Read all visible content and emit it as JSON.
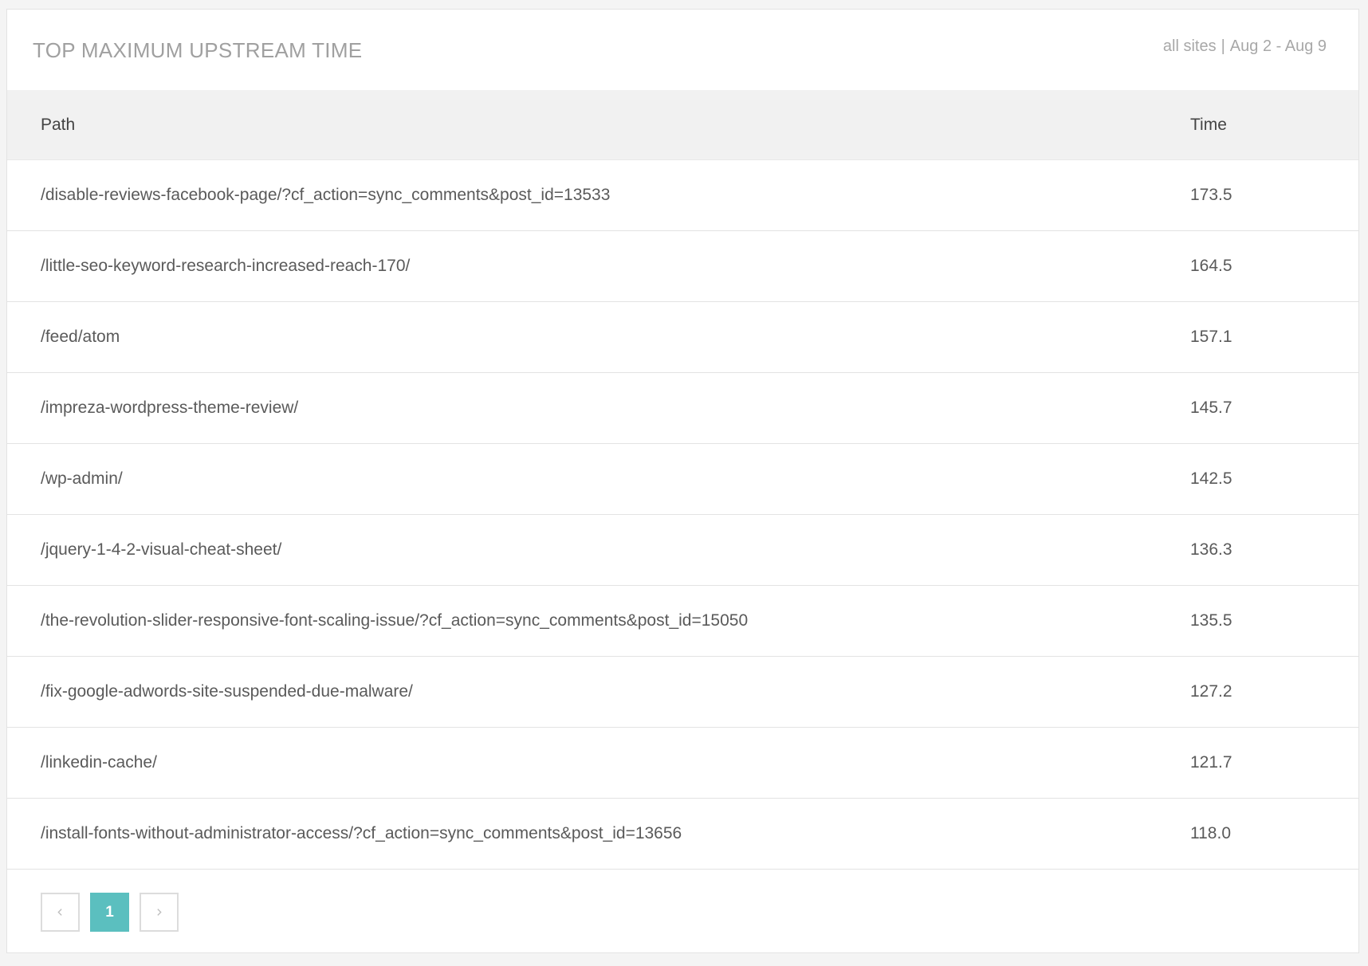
{
  "panel": {
    "title": "TOP MAXIMUM UPSTREAM TIME",
    "scope": "all sites",
    "separator": "|",
    "date_range": "Aug 2 - Aug 9"
  },
  "table": {
    "headers": {
      "path": "Path",
      "time": "Time"
    },
    "rows": [
      {
        "path": "/disable-reviews-facebook-page/?cf_action=sync_comments&post_id=13533",
        "time": "173.5"
      },
      {
        "path": "/little-seo-keyword-research-increased-reach-170/",
        "time": "164.5"
      },
      {
        "path": "/feed/atom",
        "time": "157.1"
      },
      {
        "path": "/impreza-wordpress-theme-review/",
        "time": "145.7"
      },
      {
        "path": "/wp-admin/",
        "time": "142.5"
      },
      {
        "path": "/jquery-1-4-2-visual-cheat-sheet/",
        "time": "136.3"
      },
      {
        "path": "/the-revolution-slider-responsive-font-scaling-issue/?cf_action=sync_comments&post_id=15050",
        "time": "135.5"
      },
      {
        "path": "/fix-google-adwords-site-suspended-due-malware/",
        "time": "127.2"
      },
      {
        "path": "/linkedin-cache/",
        "time": "121.7"
      },
      {
        "path": "/install-fonts-without-administrator-access/?cf_action=sync_comments&post_id=13656",
        "time": "118.0"
      }
    ]
  },
  "pagination": {
    "prev_icon": "chevron-left-icon",
    "next_icon": "chevron-right-icon",
    "current_page": "1",
    "active_color": "#5bbfbf"
  }
}
